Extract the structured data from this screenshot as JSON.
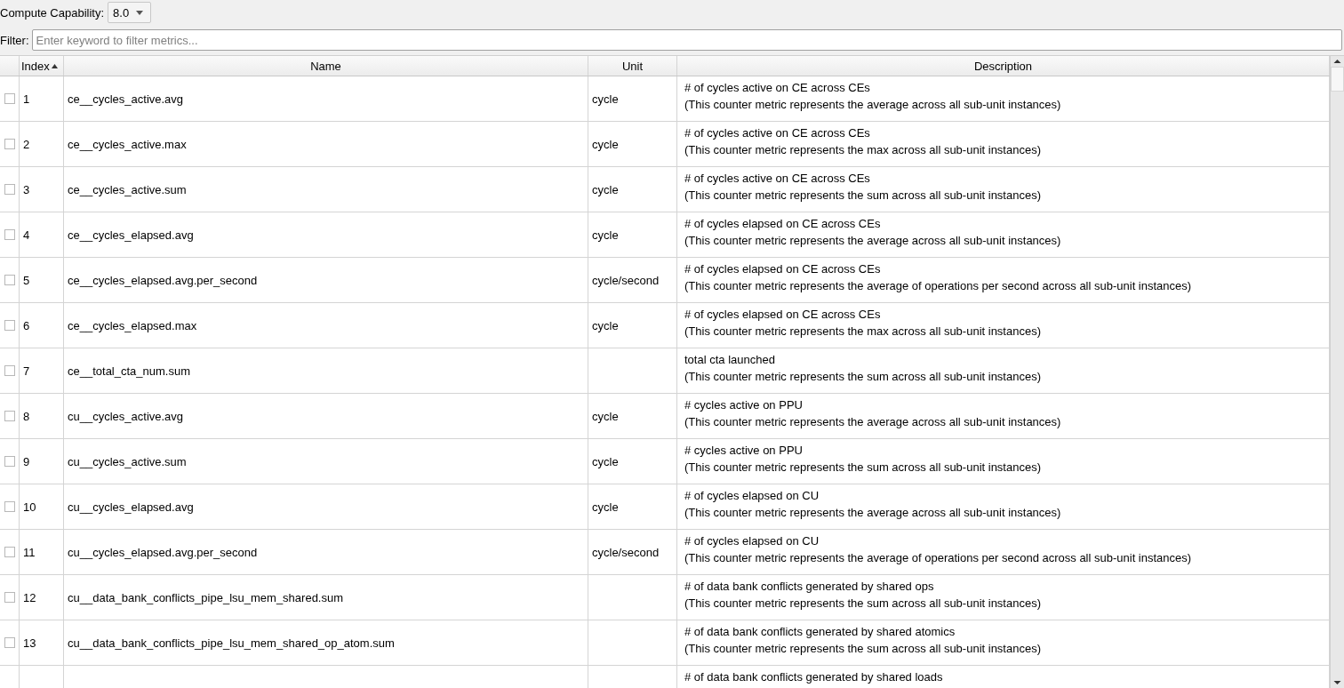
{
  "toolbar": {
    "compute_capability_label": "Compute Capability:",
    "compute_capability_value": "8.0",
    "filter_label": "Filter:",
    "filter_placeholder": "Enter keyword to filter metrics..."
  },
  "table": {
    "columns": [
      {
        "label": "Index",
        "sorted": true
      },
      {
        "label": "Name",
        "sorted": false
      },
      {
        "label": "Unit",
        "sorted": false
      },
      {
        "label": "Description",
        "sorted": false
      }
    ],
    "rows": [
      {
        "checked": false,
        "index": "1",
        "name": "ce__cycles_active.avg",
        "unit": "cycle",
        "description": "# of cycles active on CE across CEs\n(This counter metric represents the average across all sub-unit instances)"
      },
      {
        "checked": false,
        "index": "2",
        "name": "ce__cycles_active.max",
        "unit": "cycle",
        "description": "# of cycles active on CE across CEs\n(This counter metric represents the max across all sub-unit instances)"
      },
      {
        "checked": false,
        "index": "3",
        "name": "ce__cycles_active.sum",
        "unit": "cycle",
        "description": "# of cycles active on CE across CEs\n(This counter metric represents the sum across all sub-unit instances)"
      },
      {
        "checked": false,
        "index": "4",
        "name": "ce__cycles_elapsed.avg",
        "unit": "cycle",
        "description": "# of cycles elapsed on CE across CEs\n(This counter metric represents the average across all sub-unit instances)"
      },
      {
        "checked": false,
        "index": "5",
        "name": "ce__cycles_elapsed.avg.per_second",
        "unit": "cycle/second",
        "description": "# of cycles elapsed on CE across CEs\n(This counter metric represents the average of operations per second across all sub-unit instances)"
      },
      {
        "checked": false,
        "index": "6",
        "name": "ce__cycles_elapsed.max",
        "unit": "cycle",
        "description": "# of cycles elapsed on CE across CEs\n(This counter metric represents the max across all sub-unit instances)"
      },
      {
        "checked": false,
        "index": "7",
        "name": "ce__total_cta_num.sum",
        "unit": "",
        "description": "total cta launched\n(This counter metric represents the sum across all sub-unit instances)"
      },
      {
        "checked": false,
        "index": "8",
        "name": "cu__cycles_active.avg",
        "unit": "cycle",
        "description": "# cycles active on PPU\n(This counter metric represents the average across all sub-unit instances)"
      },
      {
        "checked": false,
        "index": "9",
        "name": "cu__cycles_active.sum",
        "unit": "cycle",
        "description": "# cycles active on PPU\n(This counter metric represents the sum across all sub-unit instances)"
      },
      {
        "checked": false,
        "index": "10",
        "name": "cu__cycles_elapsed.avg",
        "unit": "cycle",
        "description": "# of cycles elapsed on CU\n(This counter metric represents the average across all sub-unit instances)"
      },
      {
        "checked": false,
        "index": "11",
        "name": "cu__cycles_elapsed.avg.per_second",
        "unit": "cycle/second",
        "description": "# of cycles elapsed on CU\n(This counter metric represents the average of operations per second across all sub-unit instances)"
      },
      {
        "checked": false,
        "index": "12",
        "name": "cu__data_bank_conflicts_pipe_lsu_mem_shared.sum",
        "unit": "",
        "description": "# of data bank conflicts generated by shared ops\n(This counter metric represents the sum across all sub-unit instances)"
      },
      {
        "checked": false,
        "index": "13",
        "name": "cu__data_bank_conflicts_pipe_lsu_mem_shared_op_atom.sum",
        "unit": "",
        "description": "# of data bank conflicts generated by shared atomics\n(This counter metric represents the sum across all sub-unit instances)"
      },
      {
        "description": "# of data bank conflicts generated by shared loads"
      }
    ]
  }
}
